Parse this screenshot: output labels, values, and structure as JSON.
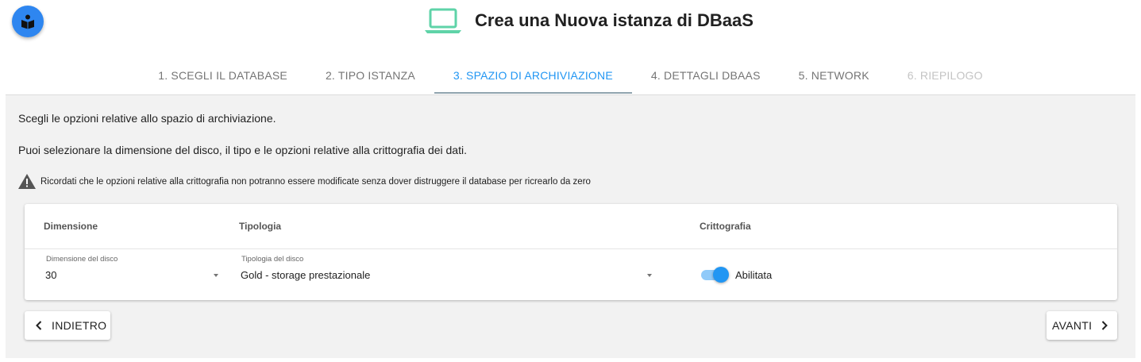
{
  "header": {
    "title": "Crea una Nuova istanza di DBaaS",
    "logo_icon": "book-reader-icon",
    "title_icon": "laptop-icon",
    "title_icon_color": "#5fd3a8",
    "logo_color": "#2e86f0"
  },
  "stepper": {
    "steps": [
      {
        "label": "1. SCEGLI IL DATABASE",
        "state": "done"
      },
      {
        "label": "2. TIPO ISTANZA",
        "state": "done"
      },
      {
        "label": "3. SPAZIO DI ARCHIVIAZIONE",
        "state": "active"
      },
      {
        "label": "4. DETTAGLI DBAAS",
        "state": "enabled"
      },
      {
        "label": "5. NETWORK",
        "state": "enabled"
      },
      {
        "label": "6. RIEPILOGO",
        "state": "disabled"
      }
    ],
    "active_color": "#2196f3"
  },
  "content": {
    "intro_line1": "Scegli le opzioni relative allo spazio di archiviazione.",
    "intro_line2": "Puoi selezionare la dimensione del disco, il tipo e le opzioni relative alla crittografia dei dati.",
    "warning_icon": "warning-icon",
    "warning_text": "Ricordati che le opzioni relative alla crittografia non potranno essere modificate senza dover distruggere il database per ricrearlo da zero"
  },
  "storage_table": {
    "columns": [
      "Dimensione",
      "Tipologia",
      "Crittografia"
    ],
    "disk_size": {
      "label": "Dimensione del disco",
      "value": "30"
    },
    "disk_type": {
      "label": "Tipologia del disco",
      "value": "Gold - storage prestazionale"
    },
    "encryption": {
      "label": "Abilitata",
      "enabled": true
    }
  },
  "footer": {
    "back_label": "INDIETRO",
    "next_label": "AVANTI"
  }
}
